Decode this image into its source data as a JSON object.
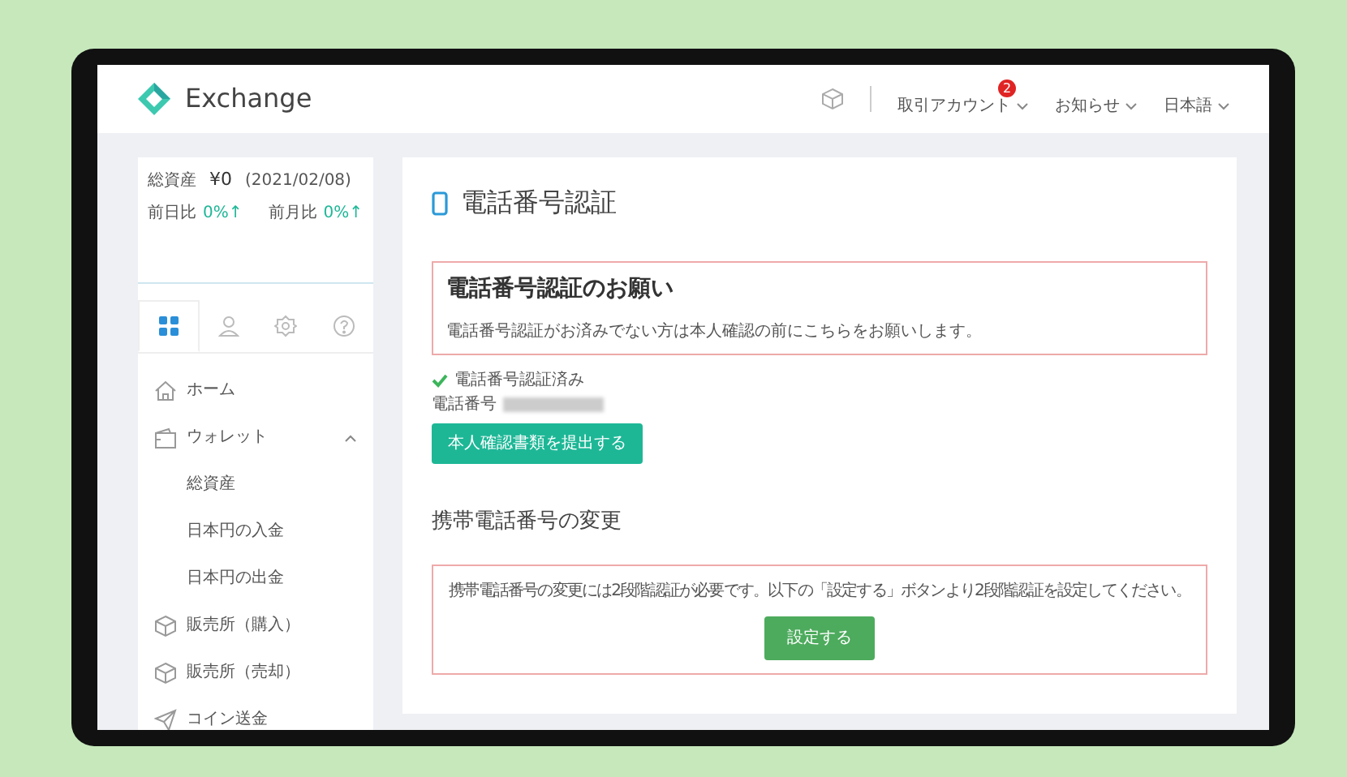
{
  "header": {
    "brand": "Exchange",
    "menus": [
      {
        "label": "取引アカウント",
        "badge": "2"
      },
      {
        "label": "お知らせ"
      },
      {
        "label": "日本語"
      }
    ]
  },
  "sidebar": {
    "summary": {
      "total_label": "総資産",
      "total": "¥0",
      "date": "(2021/02/08)",
      "changes": [
        {
          "label": "前日比",
          "value": "0%↑"
        },
        {
          "label": "前月比",
          "value": "0%↑"
        }
      ]
    },
    "tabs": [
      {
        "kind": "grid",
        "selected": true
      },
      {
        "kind": "person",
        "selected": false
      },
      {
        "kind": "gear",
        "selected": false
      },
      {
        "kind": "help",
        "selected": false
      }
    ],
    "items": [
      {
        "kind": "home",
        "label": "ホーム"
      },
      {
        "kind": "wallet",
        "label": "ウォレット",
        "expanded": true,
        "children": [
          {
            "label": "総資産"
          },
          {
            "label": "日本円の入金"
          },
          {
            "label": "日本円の出金"
          }
        ]
      },
      {
        "kind": "box",
        "label": "販売所（購入）"
      },
      {
        "kind": "box",
        "label": "販売所（売却）"
      },
      {
        "kind": "send",
        "label": "コイン送金"
      }
    ]
  },
  "main": {
    "title": "電話番号認証",
    "notice": {
      "title": "電話番号認証のお願い",
      "text": "電話番号認証がお済みでない方は本人確認の前にこちらをお願いします。"
    },
    "status": {
      "verified": true,
      "label": "電話番号認証済み"
    },
    "phone_label": "電話番号",
    "submit_button": "本人確認書類を提出する",
    "change": {
      "title": "携帯電話番号の変更",
      "text": "携帯電話番号の変更には2段階認証が必要です。以下の「設定する」ボタンより2段階認証を設定してください。",
      "button": "設定する"
    }
  }
}
